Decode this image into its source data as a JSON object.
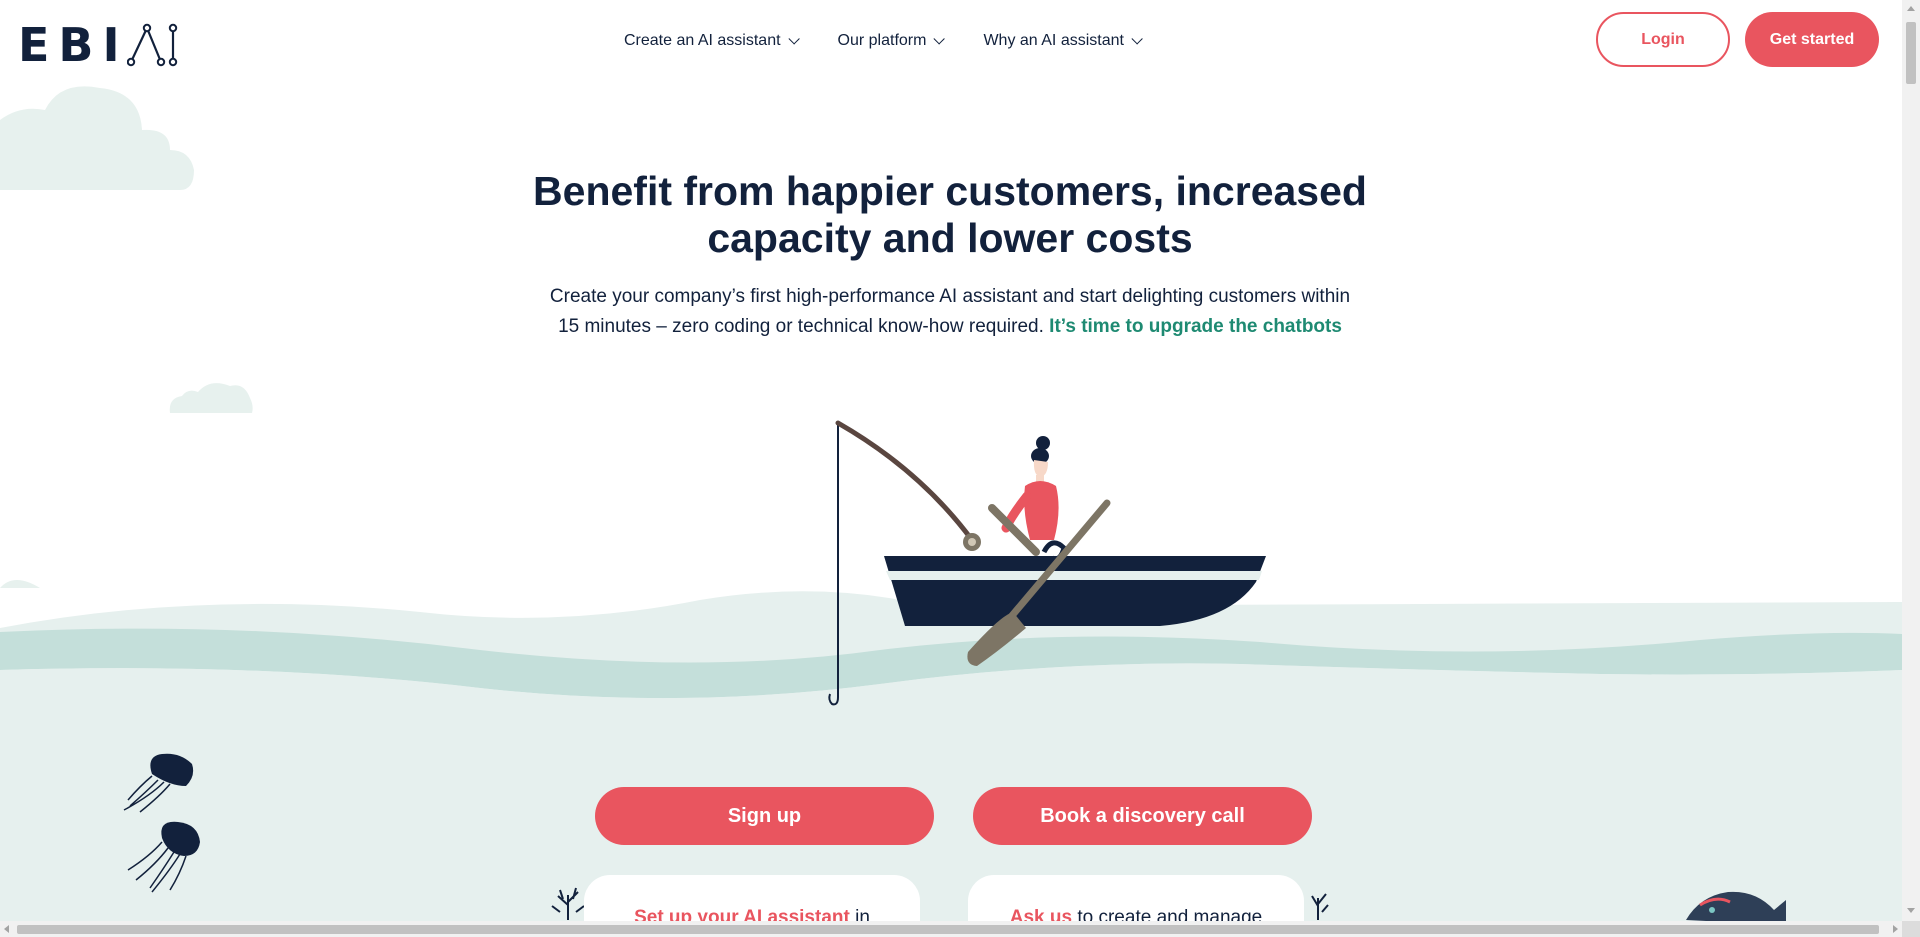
{
  "brand": {
    "name": "EBI",
    "accent": "#e9555f",
    "navy": "#12213c",
    "teal": "#1e8a72"
  },
  "nav": {
    "items": [
      {
        "label": "Create an AI assistant"
      },
      {
        "label": "Our platform"
      },
      {
        "label": "Why an AI assistant"
      }
    ],
    "login_label": "Login",
    "get_started_label": "Get started"
  },
  "hero": {
    "title_line1": "Benefit from happier customers, increased",
    "title_line2": "capacity and lower costs",
    "subtitle_line1": "Create your company’s first high-performance AI assistant and start delighting customers within",
    "subtitle_line2": "15 minutes – zero coding or technical know-how required.",
    "subtitle_link": "It’s time to upgrade the chatbots"
  },
  "cta": {
    "signup_label": "Sign up",
    "book_label": "Book a discovery call"
  },
  "cards": [
    {
      "highlight": "Set up your AI assistant",
      "rest": " in"
    },
    {
      "highlight": "Ask us",
      "rest": " to create and manage"
    }
  ],
  "icons": [
    "logo-ai-icon",
    "chevron-down-icon",
    "jellyfish-icon",
    "coral-icon",
    "fish-icon",
    "cloud-icon"
  ]
}
